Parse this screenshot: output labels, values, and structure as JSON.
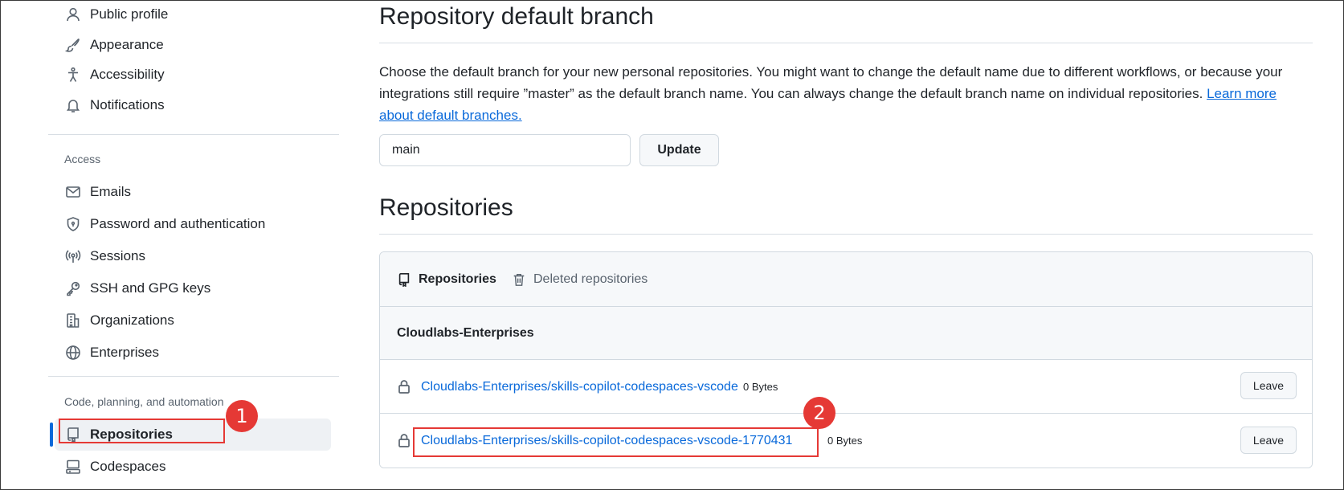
{
  "sidebar": {
    "items_top": [
      {
        "label": "Public profile",
        "icon": "person-icon"
      },
      {
        "label": "Appearance",
        "icon": "paintbrush-icon"
      },
      {
        "label": "Accessibility",
        "icon": "accessibility-icon"
      },
      {
        "label": "Notifications",
        "icon": "bell-icon"
      }
    ],
    "access_heading": "Access",
    "access_items": [
      {
        "label": "Emails",
        "icon": "mail-icon"
      },
      {
        "label": "Password and authentication",
        "icon": "shield-lock-icon"
      },
      {
        "label": "Sessions",
        "icon": "broadcast-icon"
      },
      {
        "label": "SSH and GPG keys",
        "icon": "key-icon"
      },
      {
        "label": "Organizations",
        "icon": "organization-icon"
      },
      {
        "label": "Enterprises",
        "icon": "globe-icon"
      }
    ],
    "code_heading": "Code, planning, and automation",
    "code_items": [
      {
        "label": "Repositories",
        "icon": "repo-icon",
        "selected": true
      },
      {
        "label": "Codespaces",
        "icon": "codespaces-icon"
      }
    ]
  },
  "default_branch": {
    "heading": "Repository default branch",
    "description": "Choose the default branch for your new personal repositories. You might want to change the default name due to different workflows, or because your integrations still require ”master” as the default branch name. You can always change the default branch name on individual repositories.",
    "learn_more": "Learn more about default branches.",
    "input_value": "main",
    "update_label": "Update"
  },
  "repositories": {
    "heading": "Repositories",
    "tabs": [
      {
        "label": "Repositories",
        "icon": "repo-icon",
        "active": true
      },
      {
        "label": "Deleted repositories",
        "icon": "trash-icon",
        "active": false
      }
    ],
    "org_name": "Cloudlabs-Enterprises",
    "rows": [
      {
        "name": "Cloudlabs-Enterprises/skills-copilot-codespaces-vscode",
        "size": "0 Bytes",
        "action": "Leave"
      },
      {
        "name": "Cloudlabs-Enterprises/skills-copilot-codespaces-vscode-1770431",
        "size": "0 Bytes",
        "action": "Leave"
      }
    ]
  },
  "annotations": [
    {
      "number": "1"
    },
    {
      "number": "2"
    }
  ],
  "colors": {
    "accent": "#0969da",
    "annotation": "#e53935",
    "selected_bg": "#eef1f4"
  }
}
